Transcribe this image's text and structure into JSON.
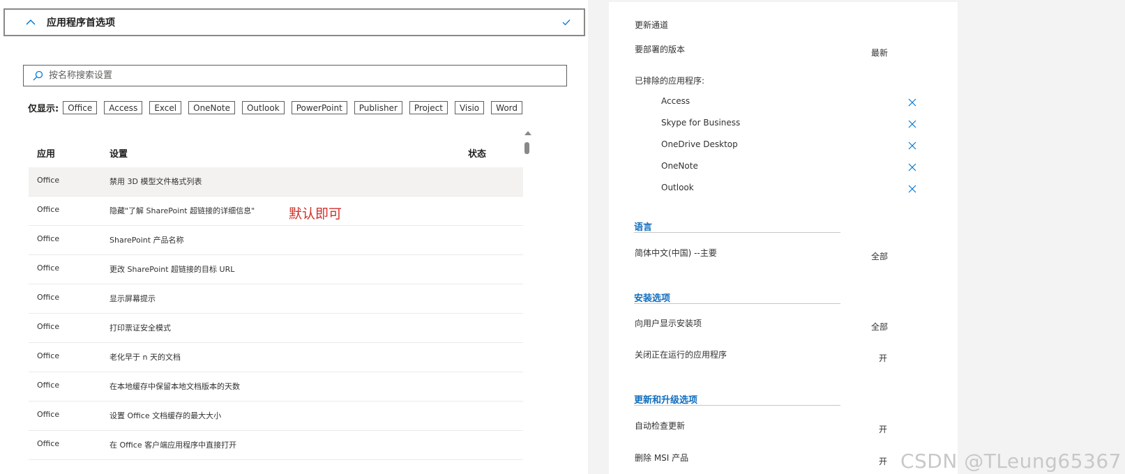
{
  "section": {
    "title": "应用程序首选项"
  },
  "search": {
    "placeholder": "按名称搜索设置"
  },
  "filters": {
    "label": "仅显示:",
    "chips": [
      "Office",
      "Access",
      "Excel",
      "OneNote",
      "Outlook",
      "PowerPoint",
      "Publisher",
      "Project",
      "Visio",
      "Word"
    ]
  },
  "table": {
    "headers": {
      "app": "应用",
      "setting": "设置",
      "status": "状态"
    },
    "rows": [
      {
        "app": "Office",
        "setting": "禁用 3D 模型文件格式列表"
      },
      {
        "app": "Office",
        "setting": "隐藏\"了解 SharePoint 超链接的详细信息\""
      },
      {
        "app": "Office",
        "setting": "SharePoint 产品名称"
      },
      {
        "app": "Office",
        "setting": "更改 SharePoint 超链接的目标 URL"
      },
      {
        "app": "Office",
        "setting": "显示屏幕提示"
      },
      {
        "app": "Office",
        "setting": "打印票证安全模式"
      },
      {
        "app": "Office",
        "setting": "老化早于 n 天的文档"
      },
      {
        "app": "Office",
        "setting": "在本地缓存中保留本地文档版本的天数"
      },
      {
        "app": "Office",
        "setting": "设置 Office 文档缓存的最大大小"
      },
      {
        "app": "Office",
        "setting": "在 Office 客户端应用程序中直接打开"
      }
    ]
  },
  "annotation": {
    "text": "默认即可",
    "color": "#d0302b"
  },
  "right": {
    "update_channel_label": "更新通道",
    "version_label": "要部署的版本",
    "version_value": "最新",
    "excluded_label": "已排除的应用程序:",
    "excluded_apps": [
      "Access",
      "Skype for Business",
      "OneDrive Desktop",
      "OneNote",
      "Outlook"
    ],
    "language": {
      "title": "语言",
      "item_label": "简体中文(中国) --主要",
      "item_value": "全部"
    },
    "install": {
      "title": "安装选项",
      "show_label": "向用户显示安装项",
      "show_value": "全部",
      "close_label": "关闭正在运行的应用程序",
      "close_value": "开"
    },
    "updates": {
      "title": "更新和升级选项",
      "auto_label": "自动检查更新",
      "auto_value": "开",
      "msi_label": "删除 MSI 产品",
      "msi_value": "开"
    }
  },
  "watermark": "CSDN @TLeung65367",
  "colors": {
    "accent": "#106ebe",
    "annotation": "#d0302b"
  }
}
